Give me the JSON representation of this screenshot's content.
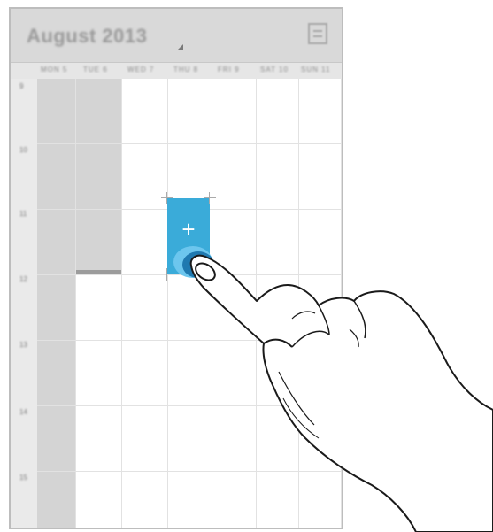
{
  "calendar": {
    "month_title": "August 2013",
    "weekdays": [
      "MON 5",
      "TUE 6",
      "WED 7",
      "THU 8",
      "FRI 9",
      "SAT 10",
      "SUN 11"
    ],
    "hours": [
      "9",
      "10",
      "11",
      "12",
      "13",
      "14",
      "15"
    ],
    "new_event_symbol": "+"
  },
  "colors": {
    "new_event": "#3aabd9",
    "touch_outer": "#6cc6ee",
    "touch_inner": "#1f79b0"
  },
  "icons": {
    "menu": "menu-icon",
    "dropdown": "chevron-down-icon",
    "add": "plus-icon"
  }
}
